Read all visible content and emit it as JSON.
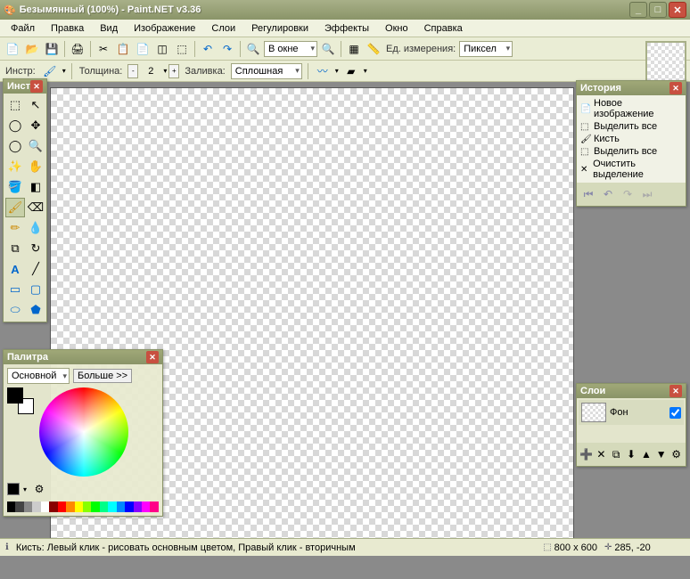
{
  "title": "Безымянный (100%) - Paint.NET v3.36",
  "menu": [
    "Файл",
    "Правка",
    "Вид",
    "Изображение",
    "Слои",
    "Регулировки",
    "Эффекты",
    "Окно",
    "Справка"
  ],
  "toolbar1": {
    "zoom_label": "В окне",
    "units_label": "Ед. измерения:",
    "units_value": "Пиксел"
  },
  "toolbar2": {
    "tool_label": "Инстр:",
    "width_label": "Толщина:",
    "width_value": "2",
    "fill_label": "Заливка:",
    "fill_value": "Сплошная"
  },
  "panels": {
    "tools_title": "Инст",
    "history_title": "История",
    "layers_title": "Слои",
    "palette_title": "Палитра"
  },
  "history_items": [
    {
      "icon": "📄",
      "label": "Новое изображение"
    },
    {
      "icon": "⬚",
      "label": "Выделить все"
    },
    {
      "icon": "🖌",
      "label": "Кисть"
    },
    {
      "icon": "⬚",
      "label": "Выделить все"
    },
    {
      "icon": "✕",
      "label": "Очистить выделение"
    }
  ],
  "layer": {
    "name": "Фон"
  },
  "palette": {
    "mode": "Основной",
    "more": "Больше >>",
    "strip": [
      "#000",
      "#444",
      "#888",
      "#ccc",
      "#fff",
      "#800",
      "#f00",
      "#f80",
      "#ff0",
      "#8f0",
      "#0f0",
      "#0f8",
      "#0ff",
      "#08f",
      "#00f",
      "#80f",
      "#f0f",
      "#f08"
    ]
  },
  "status": {
    "hint": "Кисть: Левый клик - рисовать основным цветом, Правый клик - вторичным",
    "size": "800 x 600",
    "pos": "285, -20"
  }
}
